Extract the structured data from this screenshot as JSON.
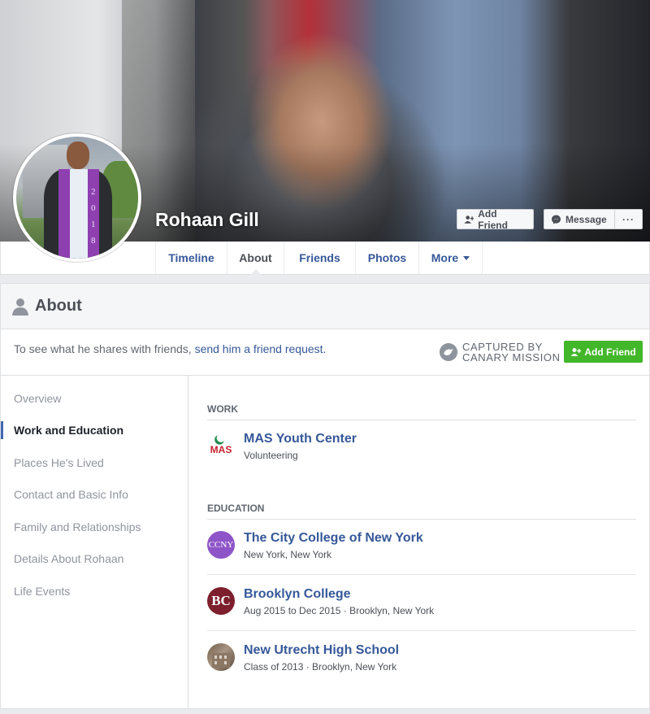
{
  "profile": {
    "name": "Rohaan Gill",
    "add_friend_label": "Add Friend",
    "message_label": "Message",
    "more_label": "···",
    "avatar_year": [
      "2",
      "0",
      "1",
      "8"
    ]
  },
  "nav": {
    "tabs": [
      {
        "label": "Timeline"
      },
      {
        "label": "About"
      },
      {
        "label": "Friends"
      },
      {
        "label": "Photos"
      },
      {
        "label": "More"
      }
    ]
  },
  "about": {
    "title": "About",
    "notice_text": "To see what he shares with friends, ",
    "notice_link": "send him a friend request.",
    "captured_line1": "CAPTURED BY",
    "captured_line2": "CANARY MISSION",
    "add_friend_label": "Add Friend",
    "sidebar": [
      {
        "label": "Overview"
      },
      {
        "label": "Work and Education"
      },
      {
        "label": "Places He's Lived"
      },
      {
        "label": "Contact and Basic Info"
      },
      {
        "label": "Family and Relationships"
      },
      {
        "label": "Details About Rohaan"
      },
      {
        "label": "Life Events"
      }
    ],
    "work_title": "WORK",
    "work": [
      {
        "name": "MAS Youth Center",
        "detail": "Volunteering",
        "logo_text": "MAS"
      }
    ],
    "education_title": "EDUCATION",
    "education": [
      {
        "name": "The City College of New York",
        "detail": "New York, New York",
        "logo_text": "CCNY"
      },
      {
        "name": "Brooklyn College",
        "detail": "Aug 2015 to Dec 2015 · Brooklyn, New York",
        "logo_text": "BC"
      },
      {
        "name": "New Utrecht High School",
        "detail": "Class of 2013 · Brooklyn, New York",
        "logo_text": ""
      }
    ]
  },
  "colors": {
    "link_blue": "#365899",
    "green_button": "#42b72a",
    "ccny_purple": "#8e55c8",
    "bc_maroon": "#7d1f2c",
    "mas_red": "#c8202f",
    "mas_green": "#1f8a4c"
  }
}
